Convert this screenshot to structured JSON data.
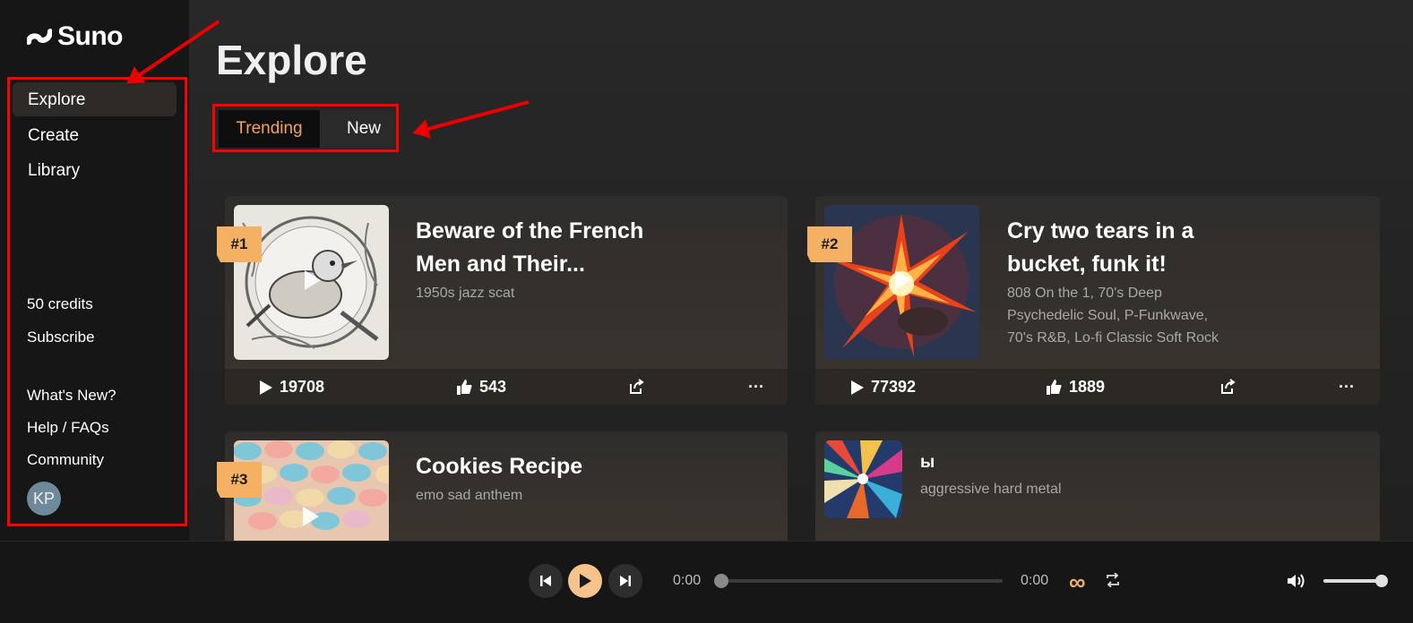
{
  "app": {
    "name": "Suno"
  },
  "sidebar": {
    "nav": [
      {
        "label": "Explore",
        "active": true
      },
      {
        "label": "Create",
        "active": false
      },
      {
        "label": "Library",
        "active": false
      }
    ],
    "credits": "50 credits",
    "subscribe": "Subscribe",
    "links": [
      "What's New?",
      "Help / FAQs",
      "Community"
    ],
    "avatar_initials": "KP"
  },
  "page": {
    "title": "Explore"
  },
  "tabs": [
    {
      "label": "Trending",
      "active": true
    },
    {
      "label": "New",
      "active": false
    }
  ],
  "songs": [
    {
      "rank": "#1",
      "title_line1": "Beware of the French",
      "title_line2": "Men and Their...",
      "genre_lines": [
        "1950s jazz scat"
      ],
      "plays": "19708",
      "likes": "543"
    },
    {
      "rank": "#2",
      "title_line1": "Cry two tears in a",
      "title_line2": "bucket, funk it!",
      "genre_lines": [
        "808 On the 1, 70's Deep",
        "Psychedelic Soul, P-Funkwave,",
        "70's R&B, Lo-fi Classic Soft Rock"
      ],
      "plays": "77392",
      "likes": "1889"
    },
    {
      "rank": "#3",
      "title_line1": "Cookies Recipe",
      "title_line2": "",
      "genre_lines": [
        "emo sad anthem"
      ]
    },
    {
      "rank": "",
      "title_line1": "ы",
      "title_line2": "",
      "genre_lines": [
        "aggressive hard metal"
      ]
    }
  ],
  "player": {
    "time_current": "0:00",
    "time_total": "0:00",
    "progress": 0,
    "volume": 1.0
  },
  "colors": {
    "accent": "#f6a15c",
    "rank_badge": "#f4b164",
    "highlight_box": "#ff0000"
  }
}
